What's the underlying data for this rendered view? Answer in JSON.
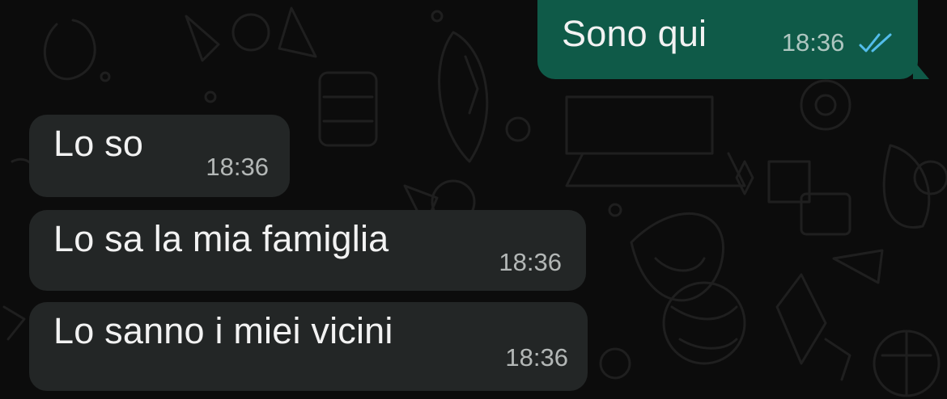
{
  "messages": [
    {
      "direction": "out",
      "text": "Sono qui",
      "time": "18:36",
      "status_icon": "double-check-icon",
      "status": "read"
    },
    {
      "direction": "in",
      "text": "Lo so",
      "time": "18:36"
    },
    {
      "direction": "in",
      "text": "Lo sa la mia famiglia",
      "time": "18:36"
    },
    {
      "direction": "in",
      "text": "Lo sanno i miei vicini",
      "time": "18:36"
    }
  ],
  "colors": {
    "background": "#0c0c0c",
    "incoming_bubble": "#232626",
    "outgoing_bubble": "#0f5a48",
    "read_ticks": "#53bdeb"
  }
}
